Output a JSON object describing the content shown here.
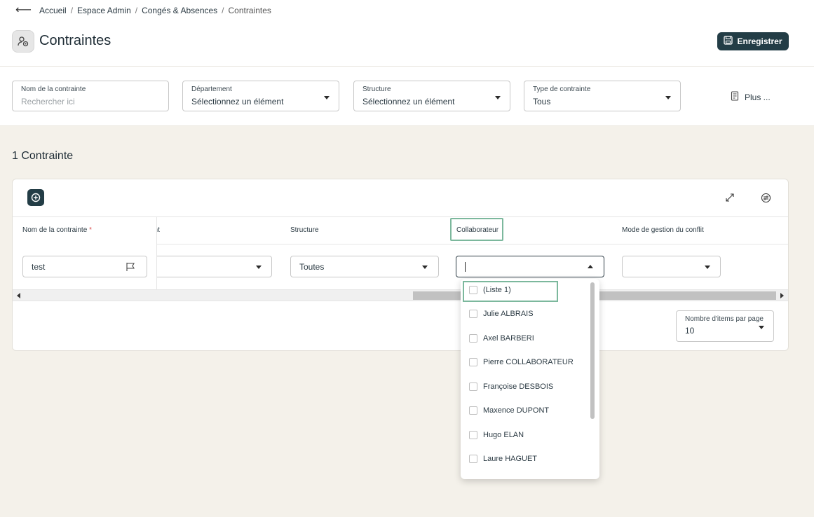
{
  "breadcrumb": [
    "Accueil",
    "Espace Admin",
    "Congés & Absences",
    "Contraintes"
  ],
  "page": {
    "title": "Contraintes",
    "save_label": "Enregistrer"
  },
  "filters": {
    "name": {
      "label": "Nom de la contrainte",
      "placeholder": "Rechercher ici"
    },
    "department": {
      "label": "Département",
      "value": "Sélectionnez un élément"
    },
    "structure": {
      "label": "Structure",
      "value": "Sélectionnez un élément"
    },
    "type": {
      "label": "Type de contrainte",
      "value": "Tous"
    },
    "more_label": "Plus ..."
  },
  "count_label": "1 Contrainte",
  "table": {
    "columns": {
      "name": "Nom de la contrainte",
      "required_mark": "*",
      "department_partial": "ent",
      "structure": "Structure",
      "collaborator": "Collaborateur",
      "conflict_mode": "Mode de gestion du conflit"
    },
    "row": {
      "name": "test",
      "structure": "Toutes",
      "collaborator": "",
      "conflict_mode": ""
    }
  },
  "pagination": {
    "label": "Nombre d'items par page",
    "value": "10"
  },
  "collaborator_options": [
    "(Liste 1)",
    "Julie ALBRAIS",
    "Axel BARBERI",
    "Pierre COLLABORATEUR",
    "Françoise DESBOIS",
    "Maxence DUPONT",
    "Hugo ELAN",
    "Laure HAGUET"
  ],
  "colors": {
    "primary": "#233d46",
    "focus": "#7cb89d",
    "background": "#f4f1ea"
  }
}
